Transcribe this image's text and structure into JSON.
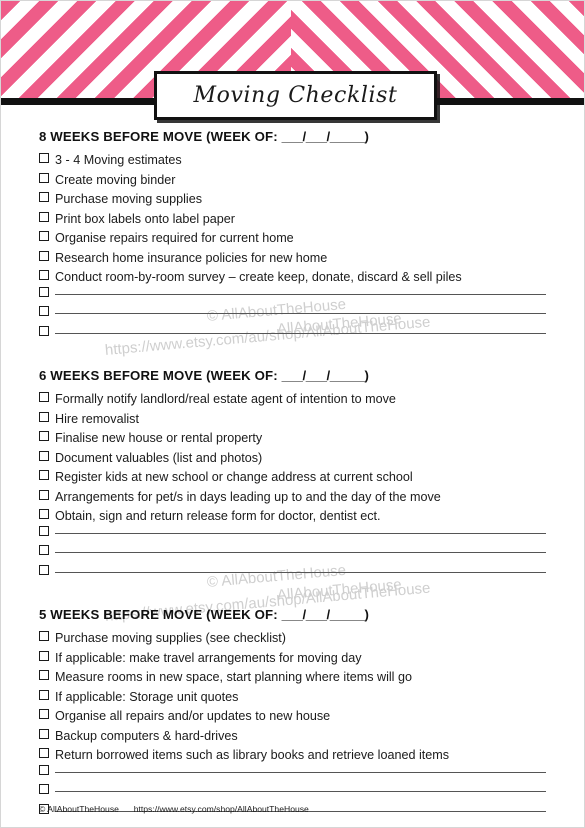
{
  "document": {
    "title": "Moving Checklist"
  },
  "theme": {
    "chevron_pink": "#ee5c88",
    "rule_black": "#111111",
    "paper_white": "#ffffff",
    "watermark_gray": "#cfcfcf"
  },
  "watermarks": {
    "copyright": "© AllAboutTheHouse",
    "shop_url": "https://www.etsy.com/au/shop/AllAboutTheHouse",
    "shop_name_tail": "AllAboutTheHouse"
  },
  "sections": [
    {
      "heading_prefix": "8 WEEKS BEFORE MOVE (WEEK OF:",
      "heading_blanks": "___/___/_____",
      "heading_suffix": ")",
      "items": [
        "3 - 4 Moving estimates",
        "Create moving binder",
        "Purchase moving supplies",
        "Print box labels onto label paper",
        "Organise repairs required for current home",
        "Research home insurance policies for new home",
        "Conduct room-by-room survey – create keep, donate, discard & sell piles"
      ],
      "blank_lines": 3
    },
    {
      "heading_prefix": "6 WEEKS BEFORE MOVE (WEEK OF:",
      "heading_blanks": "___/___/_____",
      "heading_suffix": ")",
      "items": [
        "Formally notify landlord/real estate agent of intention to move",
        "Hire removalist",
        "Finalise new house or rental property",
        "Document valuables (list and photos)",
        "Register kids at new school or change address at current school",
        "Arrangements for pet/s in days leading up to and the day of the move",
        "Obtain, sign and return release form for doctor, dentist ect."
      ],
      "blank_lines": 3
    },
    {
      "heading_prefix": "5 WEEKS BEFORE MOVE (WEEK OF:",
      "heading_blanks": "___/___/_____",
      "heading_suffix": ")",
      "items": [
        "Purchase moving supplies (see checklist)",
        "If applicable: make travel arrangements for moving day",
        "Measure rooms in new space, start planning where items will go",
        "If applicable: Storage unit quotes",
        "Organise all repairs and/or updates to new house",
        "Backup computers & hard-drives",
        "Return borrowed items such as library books and retrieve loaned items"
      ],
      "blank_lines": 3
    }
  ],
  "footer": {
    "copyright": "© AllAboutTheHouse",
    "url": "https://www.etsy.com/shop/AllAboutTheHouse"
  }
}
